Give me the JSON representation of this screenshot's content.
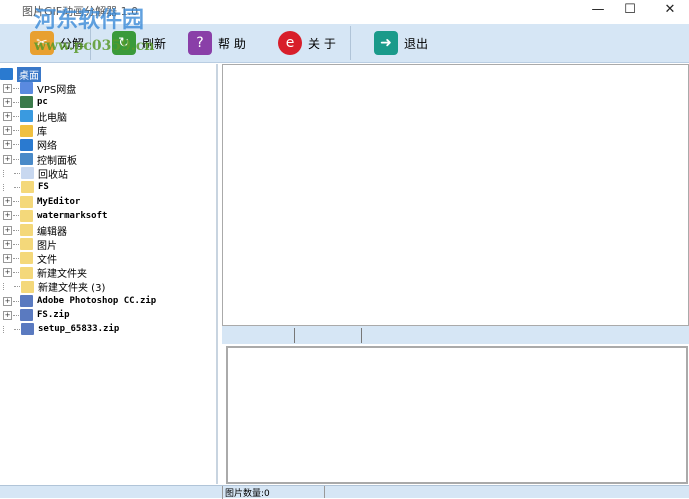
{
  "window": {
    "title": "图片GIF动画分解器 1.0",
    "minimize": "—",
    "maximize": "☐",
    "close": "✕"
  },
  "watermark": {
    "site_name": "河东软件园",
    "url": "www.pc0359.cn"
  },
  "toolbar": {
    "decompose": "分解",
    "refresh": "刷新",
    "help": "帮 助",
    "about": "关 于",
    "exit": "退出"
  },
  "tree": {
    "root": "桌面",
    "items": [
      {
        "label": "VPS网盘",
        "expand": "+",
        "icon": "cloud"
      },
      {
        "label": "pc",
        "expand": "+",
        "icon": "user"
      },
      {
        "label": "此电脑",
        "expand": "+",
        "icon": "computer"
      },
      {
        "label": "库",
        "expand": "+",
        "icon": "library"
      },
      {
        "label": "网络",
        "expand": "+",
        "icon": "network"
      },
      {
        "label": "控制面板",
        "expand": "+",
        "icon": "control-panel"
      },
      {
        "label": "回收站",
        "expand": "",
        "icon": "recycle-bin"
      },
      {
        "label": "FS",
        "expand": "",
        "icon": "folder"
      },
      {
        "label": "MyEditor",
        "expand": "+",
        "icon": "folder"
      },
      {
        "label": "watermarksoft",
        "expand": "+",
        "icon": "folder"
      },
      {
        "label": "编辑器",
        "expand": "+",
        "icon": "folder"
      },
      {
        "label": "图片",
        "expand": "+",
        "icon": "folder"
      },
      {
        "label": "文件",
        "expand": "+",
        "icon": "folder"
      },
      {
        "label": "新建文件夹",
        "expand": "+",
        "icon": "folder"
      },
      {
        "label": "新建文件夹 (3)",
        "expand": "",
        "icon": "folder"
      },
      {
        "label": "Adobe Photoshop CC.zip",
        "expand": "+",
        "icon": "zip"
      },
      {
        "label": "FS.zip",
        "expand": "+",
        "icon": "zip"
      },
      {
        "label": "setup_65833.zip",
        "expand": "",
        "icon": "zip"
      }
    ]
  },
  "status": {
    "frame_count": "图片数量:0"
  }
}
